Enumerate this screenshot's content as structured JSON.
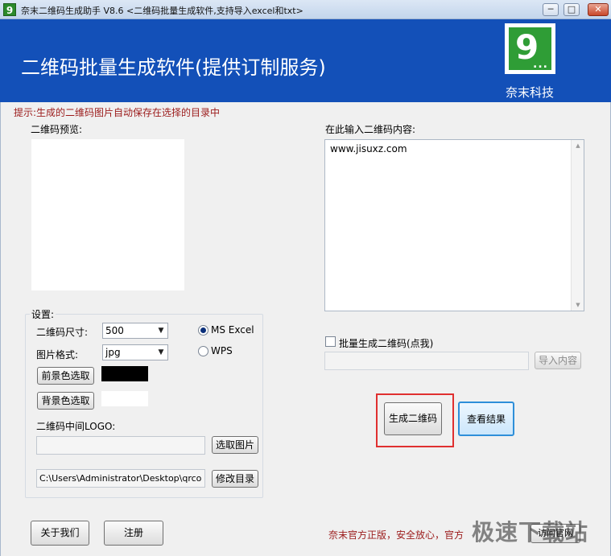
{
  "window": {
    "app_icon_glyph": "9",
    "title": "奈末二维码生成助手 V8.6    <二维码批量生成软件,支持导入excel和txt>",
    "minimize_glyph": "─",
    "maximize_glyph": "□",
    "close_glyph": "✕"
  },
  "banner": {
    "title": "二维码批量生成软件(提供订制服务)",
    "logo_glyph": "9",
    "logo_dots": "...",
    "brand": "奈末科技",
    "bg_color": "#1350b8"
  },
  "hint": "提示:生成的二维码图片自动保存在选择的目录中",
  "preview": {
    "label": "二维码预览:"
  },
  "content": {
    "label": "在此输入二维码内容:",
    "value": "www.jisuxz.com"
  },
  "settings": {
    "legend": "设置:",
    "size_label": "二维码尺寸:",
    "size_value": "500",
    "format_label": "图片格式:",
    "format_value": "jpg",
    "radio_excel": "MS  Excel",
    "radio_wps": "WPS",
    "fg_button": "前景色选取",
    "fg_color": "#000000",
    "bg_button": "背景色选取",
    "bg_color": "#ffffff",
    "logo_label": "二维码中间LOGO:",
    "logo_path": "",
    "pick_image_button": "选取图片",
    "save_path": "C:\\Users\\Administrator\\Desktop\\qrcode",
    "change_dir_button": "修改目录"
  },
  "batch": {
    "label": "批量生成二维码(点我)",
    "checked": false,
    "import_value": "",
    "import_button": "导入内容"
  },
  "actions": {
    "generate_button": "生成二维码",
    "view_button": "查看结果",
    "about_button": "关于我们",
    "register_button": "注册"
  },
  "footer": {
    "text": "奈末官方正版，安全放心，官方",
    "button": "访问官网",
    "watermark": "极速下载站"
  },
  "icons": {
    "dropdown": "chevron-down-icon",
    "scroll_up": "scroll-up-icon",
    "scroll_down": "scroll-down-icon"
  }
}
